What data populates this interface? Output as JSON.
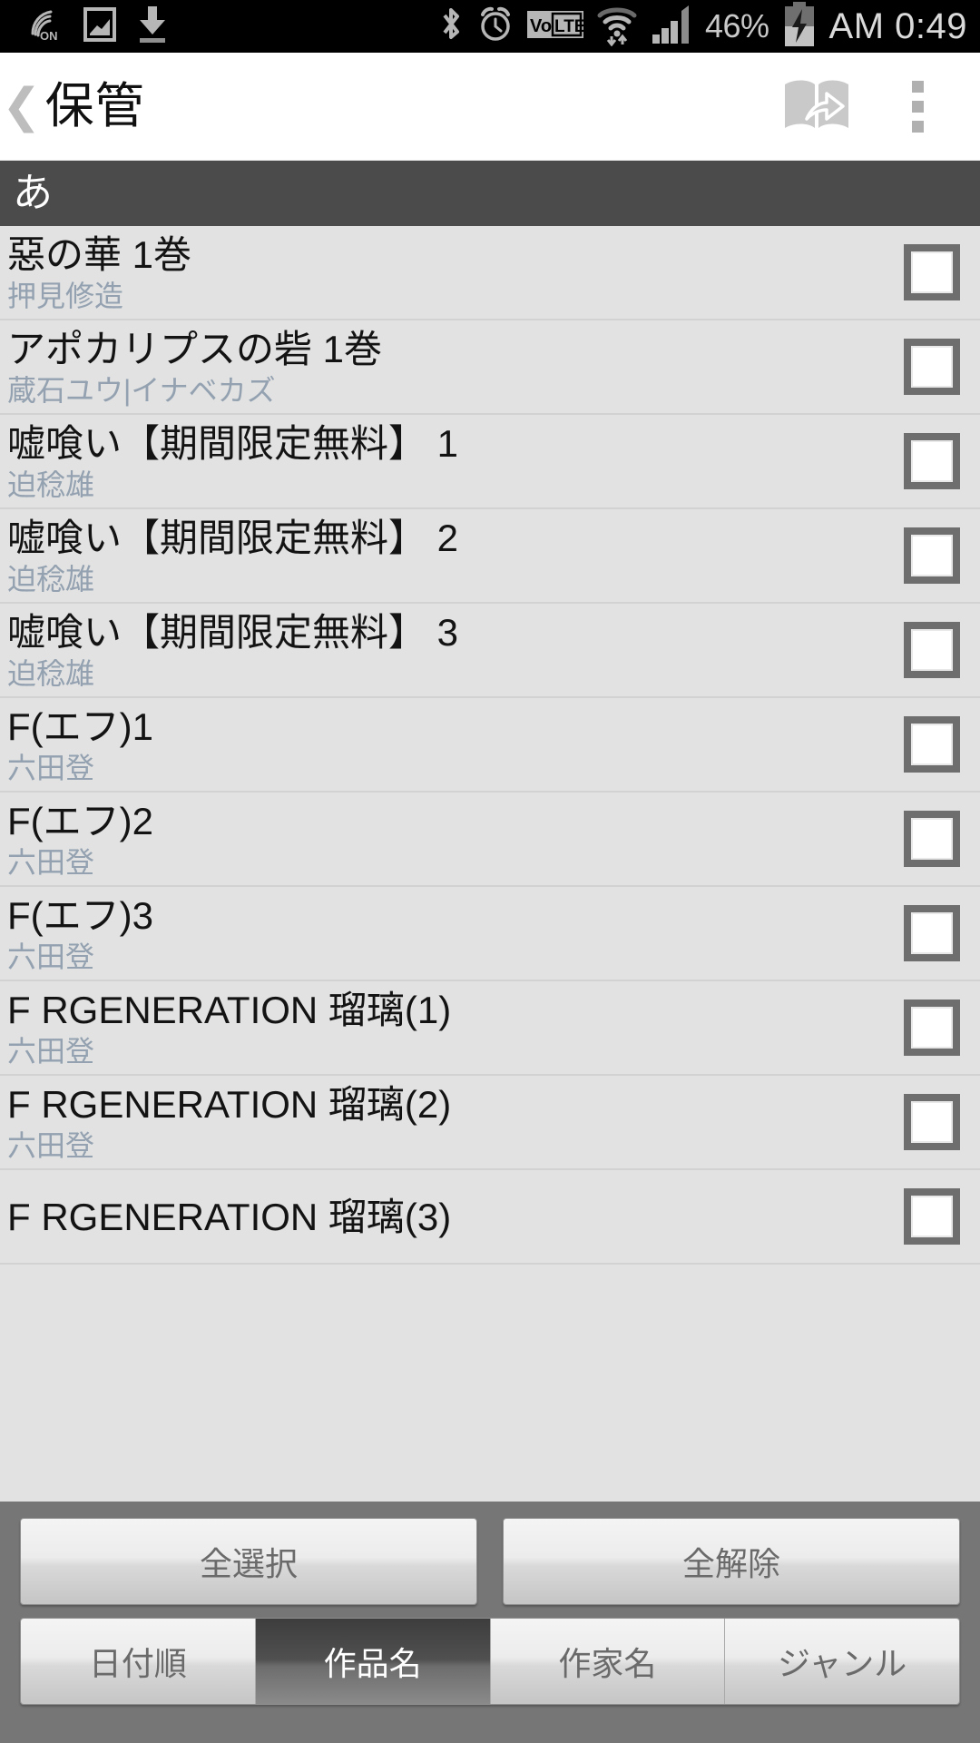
{
  "status_bar": {
    "icons": [
      {
        "name": "call-on-icon",
        "label": "ON"
      },
      {
        "name": "image-icon",
        "label": ""
      },
      {
        "name": "download-icon",
        "label": ""
      },
      {
        "name": "bluetooth-icon",
        "label": ""
      },
      {
        "name": "alarm-icon",
        "label": ""
      },
      {
        "name": "volte-icon",
        "label": "VoLTE"
      },
      {
        "name": "wifi-icon",
        "label": ""
      },
      {
        "name": "signal-icon",
        "label": ""
      }
    ],
    "battery_percent": "46%",
    "clock": "AM 0:49"
  },
  "action_bar": {
    "back_label": "❮",
    "title": "保管",
    "share_icon": "book-share-icon",
    "overflow_icon": "overflow-menu-icon"
  },
  "section": {
    "header": "あ"
  },
  "books": [
    {
      "title": "惡の華 1巻",
      "author": "押見修造",
      "checked": false
    },
    {
      "title": "アポカリプスの砦 1巻",
      "author": "蔵石ユウ|イナベカズ",
      "checked": false
    },
    {
      "title": "嘘喰い【期間限定無料】 1",
      "author": "迫稔雄",
      "checked": false
    },
    {
      "title": "嘘喰い【期間限定無料】 2",
      "author": "迫稔雄",
      "checked": false
    },
    {
      "title": "嘘喰い【期間限定無料】 3",
      "author": "迫稔雄",
      "checked": false
    },
    {
      "title": "F(エフ)1",
      "author": "六田登",
      "checked": false
    },
    {
      "title": "F(エフ)2",
      "author": "六田登",
      "checked": false
    },
    {
      "title": "F(エフ)3",
      "author": "六田登",
      "checked": false
    },
    {
      "title": "F RGENERATION 瑠璃(1)",
      "author": "六田登",
      "checked": false
    },
    {
      "title": "F RGENERATION 瑠璃(2)",
      "author": "六田登",
      "checked": false
    },
    {
      "title": "F RGENERATION 瑠璃(3)",
      "author": "",
      "checked": false
    }
  ],
  "bottom": {
    "select_all_label": "全選択",
    "deselect_all_label": "全解除",
    "tabs": [
      {
        "label": "日付順",
        "selected": false
      },
      {
        "label": "作品名",
        "selected": true
      },
      {
        "label": "作家名",
        "selected": false
      },
      {
        "label": "ジャンル",
        "selected": false
      }
    ]
  },
  "colors": {
    "status_bar_bg": "#000000",
    "action_bar_bg": "#ffffff",
    "section_header_bg": "#4b4b4b",
    "list_bg": "#e2e2e2",
    "row_divider": "#d2d2d2",
    "author_text": "#93a1b0",
    "title_text": "#131313",
    "bottom_panel_bg": "#767676",
    "tab_selected_bg": "#505050",
    "checkbox_border": "#6e6e6e"
  }
}
